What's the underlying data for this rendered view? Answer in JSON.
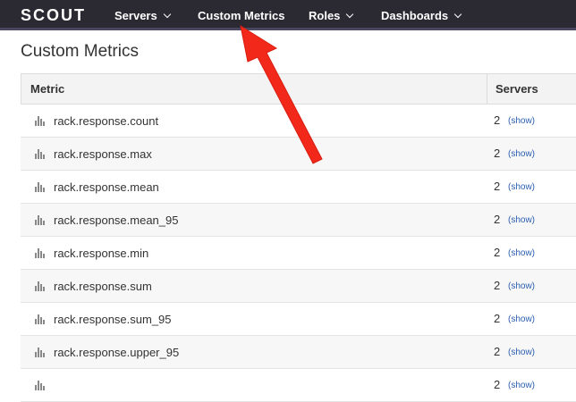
{
  "header": {
    "logo": "SCOUT",
    "nav": [
      {
        "label": "Servers",
        "dropdown": true
      },
      {
        "label": "Custom Metrics",
        "dropdown": false
      },
      {
        "label": "Roles",
        "dropdown": true
      },
      {
        "label": "Dashboards",
        "dropdown": true
      }
    ]
  },
  "page": {
    "title": "Custom Metrics"
  },
  "table": {
    "columns": [
      "Metric",
      "Servers"
    ],
    "rows": [
      {
        "metric": "rack.response.count",
        "servers": "2",
        "show": "(show)"
      },
      {
        "metric": "rack.response.max",
        "servers": "2",
        "show": "(show)"
      },
      {
        "metric": "rack.response.mean",
        "servers": "2",
        "show": "(show)"
      },
      {
        "metric": "rack.response.mean_95",
        "servers": "2",
        "show": "(show)"
      },
      {
        "metric": "rack.response.min",
        "servers": "2",
        "show": "(show)"
      },
      {
        "metric": "rack.response.sum",
        "servers": "2",
        "show": "(show)"
      },
      {
        "metric": "rack.response.sum_95",
        "servers": "2",
        "show": "(show)"
      },
      {
        "metric": "rack.response.upper_95",
        "servers": "2",
        "show": "(show)"
      },
      {
        "metric": "",
        "servers": "2",
        "show": "(show)"
      }
    ]
  },
  "colors": {
    "topbar": "#2b2a33",
    "link": "#2a5db0",
    "annotation_arrow": "#f2281a"
  },
  "icons": {
    "metric_row": "bar-chart-icon",
    "nav_dropdown": "chevron-down-icon",
    "annotation": "arrow-annotation-icon"
  }
}
